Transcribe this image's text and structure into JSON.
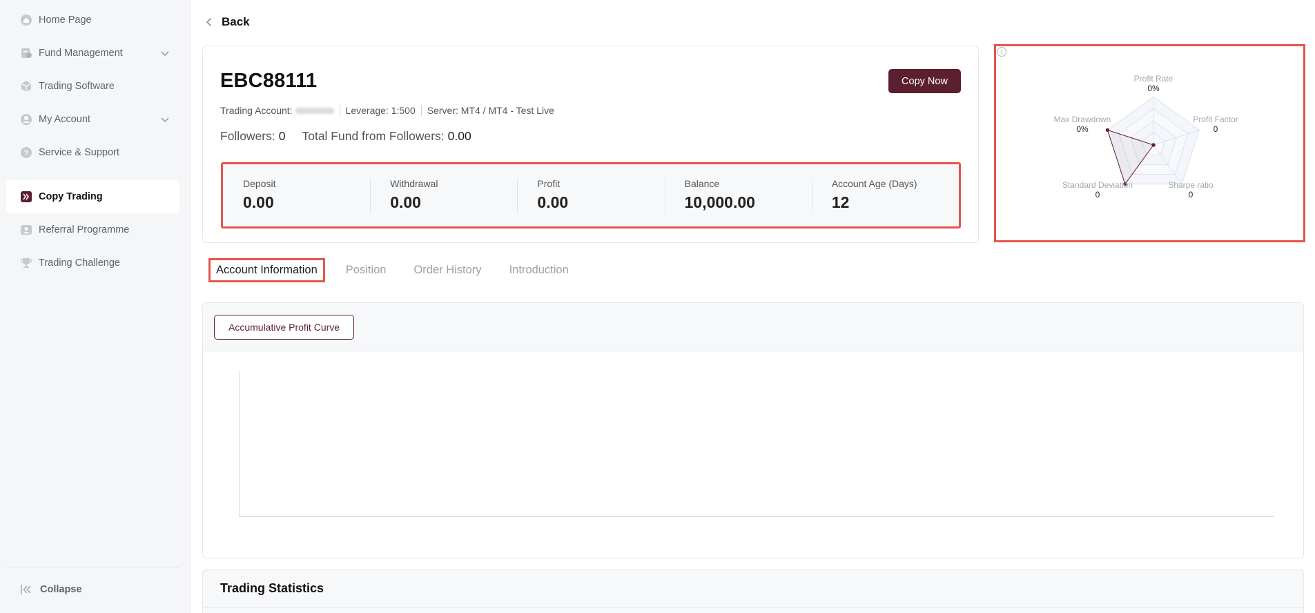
{
  "sidebar": {
    "items": [
      {
        "label": "Home Page",
        "icon": "home-icon"
      },
      {
        "label": "Fund Management",
        "icon": "wallet-icon",
        "expandable": true
      },
      {
        "label": "Trading Software",
        "icon": "box-icon"
      },
      {
        "label": "My Account",
        "icon": "user-icon",
        "expandable": true
      },
      {
        "label": "Service & Support",
        "icon": "help-icon"
      },
      {
        "label": "Copy Trading",
        "icon": "copy-trading-icon",
        "active": true
      },
      {
        "label": "Referral Programme",
        "icon": "referral-icon"
      },
      {
        "label": "Trading Challenge",
        "icon": "trophy-icon"
      }
    ],
    "collapse_label": "Collapse"
  },
  "back_label": "Back",
  "account": {
    "title": "EBC88111",
    "copy_button": "Copy Now",
    "trading_account_label": "Trading Account:",
    "leverage_label": "Leverage:",
    "leverage_value": "1:500",
    "server_label": "Server:",
    "server_value": "MT4 / MT4 - Test Live",
    "followers_label": "Followers:",
    "followers_value": "0",
    "total_fund_label": "Total Fund from Followers:",
    "total_fund_value": "0.00"
  },
  "stats": [
    {
      "label": "Deposit",
      "value": "0.00"
    },
    {
      "label": "Withdrawal",
      "value": "0.00"
    },
    {
      "label": "Profit",
      "value": "0.00"
    },
    {
      "label": "Balance",
      "value": "10,000.00"
    },
    {
      "label": "Account Age (Days)",
      "value": "12"
    }
  ],
  "radar": {
    "axes": [
      {
        "label": "Profit Rate",
        "value": "0%",
        "level": 0
      },
      {
        "label": "Profit Factor",
        "value": "0",
        "level": 0
      },
      {
        "label": "Sharpe ratio",
        "value": "0",
        "level": 0
      },
      {
        "label": "Standard Deviation",
        "value": "0",
        "level": 1
      },
      {
        "label": "Max Drawdown",
        "value": "0%",
        "level": 1
      }
    ],
    "series_color": "#5c1f30",
    "grid_color": "#dde3ee"
  },
  "tabs": [
    "Account Information",
    "Position",
    "Order History",
    "Introduction"
  ],
  "chart": {
    "chip_label": "Accumulative Profit Curve"
  },
  "trading_statistics_title": "Trading Statistics",
  "colors": {
    "accent": "#5c1f30",
    "highlight": "#e5554a"
  }
}
